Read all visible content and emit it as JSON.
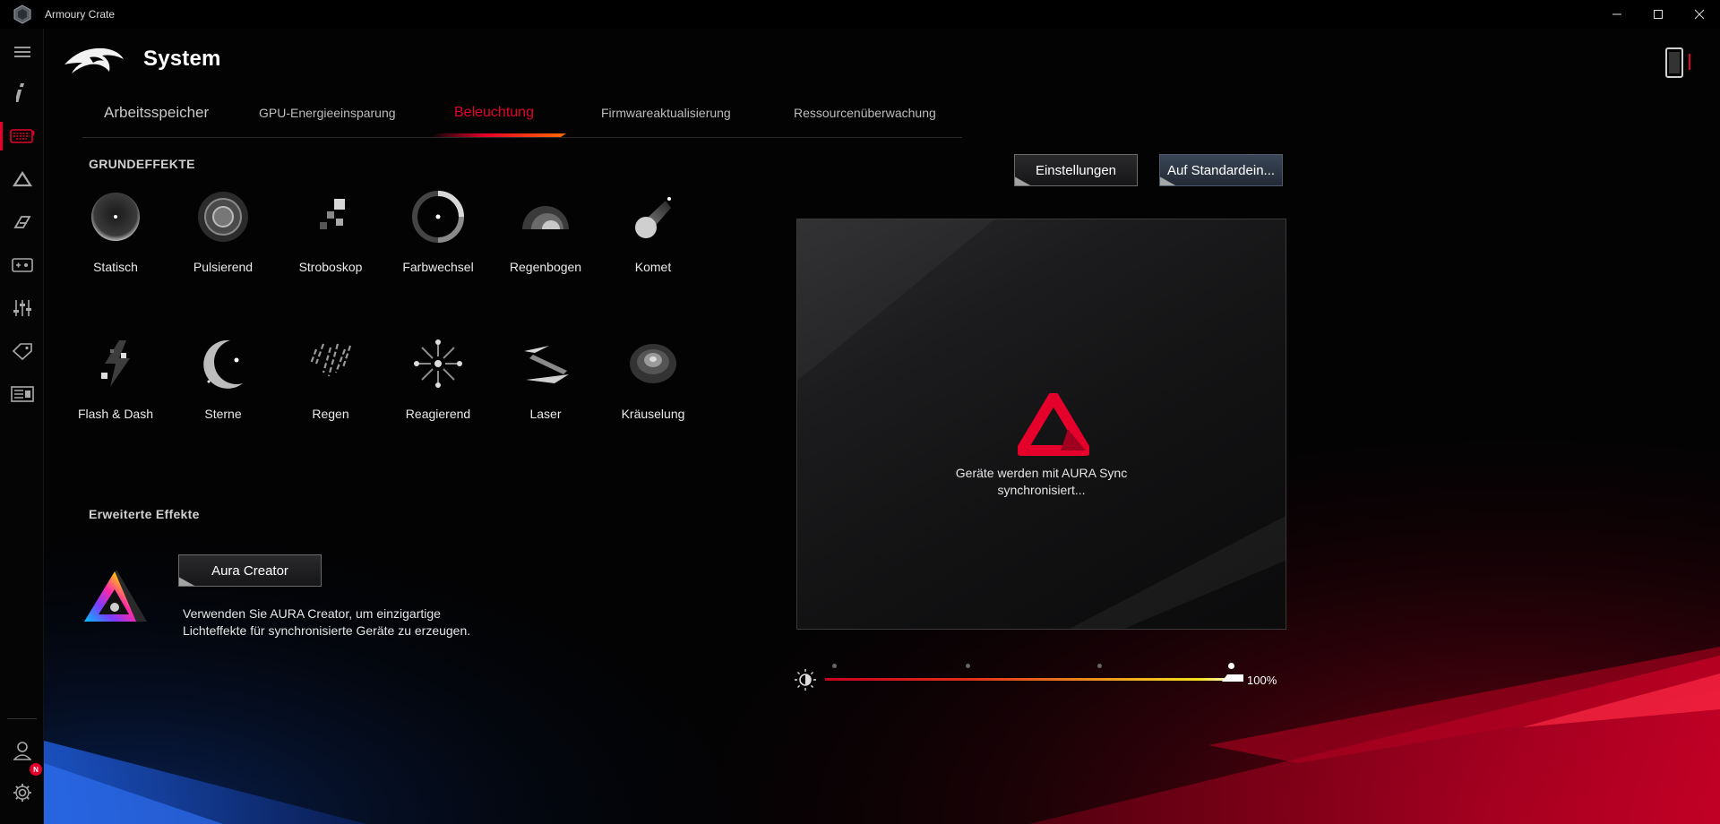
{
  "window": {
    "title": "Armoury Crate"
  },
  "header": {
    "title": "System"
  },
  "tabs": [
    {
      "label": "Arbeitsspeicher"
    },
    {
      "label": "GPU-Energieeinsparung"
    },
    {
      "label": "Beleuchtung"
    },
    {
      "label": "Firmwareaktualisierung"
    },
    {
      "label": "Ressourcenüberwachung"
    }
  ],
  "active_tab": "Beleuchtung",
  "basic_effects": {
    "title": "GRUNDEFFEKTE",
    "items": [
      {
        "label": "Statisch",
        "icon": "static-icon"
      },
      {
        "label": "Pulsierend",
        "icon": "breathing-icon"
      },
      {
        "label": "Stroboskop",
        "icon": "strobe-icon"
      },
      {
        "label": "Farbwechsel",
        "icon": "color-cycle-icon"
      },
      {
        "label": "Regenbogen",
        "icon": "rainbow-icon"
      },
      {
        "label": "Komet",
        "icon": "comet-icon"
      },
      {
        "label": "Flash & Dash",
        "icon": "flash-dash-icon"
      },
      {
        "label": "Sterne",
        "icon": "stars-icon"
      },
      {
        "label": "Regen",
        "icon": "rain-icon"
      },
      {
        "label": "Reagierend",
        "icon": "reactive-icon"
      },
      {
        "label": "Laser",
        "icon": "laser-icon"
      },
      {
        "label": "Kräuselung",
        "icon": "ripple-icon"
      }
    ]
  },
  "advanced_effects": {
    "title": "Erweiterte Effekte",
    "button": "Aura Creator",
    "description_line1": "Verwenden Sie AURA Creator, um einzigartige",
    "description_line2": "Lichteffekte für synchronisierte Geräte zu erzeugen."
  },
  "actions": {
    "settings": "Einstellungen",
    "reset": "Auf Standardein..."
  },
  "preview": {
    "message_line1": "Geräte werden mit AURA Sync",
    "message_line2": "synchronisiert..."
  },
  "brightness": {
    "value": "100%",
    "level": 1.0,
    "steps": 4
  },
  "sidebar": {
    "items": [
      "info-icon",
      "keyboard-icon",
      "aura-sync-icon",
      "gamevisual-icon",
      "game-library-icon",
      "equalizer-icon",
      "deals-icon",
      "news-icon"
    ],
    "notification_badge": "N"
  },
  "colors": {
    "accent": "#e4002b",
    "background": "#000000"
  }
}
